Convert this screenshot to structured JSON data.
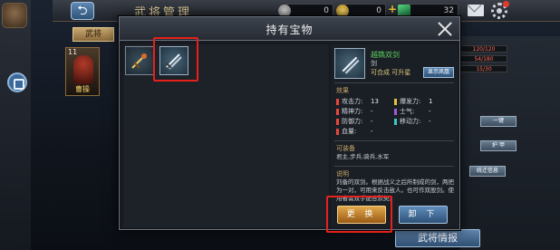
{
  "header": {
    "title": "武将管理",
    "silver": "0",
    "gold": "0",
    "jade": "32",
    "plus": "+"
  },
  "background": {
    "tab_label": "武将",
    "hero": {
      "level": "11",
      "name": "曹操"
    },
    "side_bars": [
      "120/120",
      "54/180",
      "15/30"
    ],
    "side_buttons": [
      "一键",
      "护 甲",
      "统迁信息"
    ],
    "hero_info_button": "武将情报"
  },
  "modal": {
    "title": "持有宝物",
    "detail": {
      "name": "越鐫双剑",
      "type": "剑",
      "status": "可合成  可升星",
      "show_button": "显示凤凰",
      "effects_label": "效果",
      "stats": [
        {
          "key": "攻击力:",
          "value": "13",
          "color": "#e5473a"
        },
        {
          "key": "爆发力:",
          "value": "1",
          "color": "#e6c13a"
        },
        {
          "key": "精神力:",
          "value": "-",
          "color": "#e5473a"
        },
        {
          "key": "士气:",
          "value": "-",
          "color": "#a05ad8"
        },
        {
          "key": "防御力:",
          "value": "-",
          "color": "#e5473a"
        },
        {
          "key": "移动力:",
          "value": "-",
          "color": "#3ac8c8"
        },
        {
          "key": "血量:",
          "value": "-",
          "color": "#e5473a"
        }
      ],
      "equippable_label": "可装备",
      "equippable_text": "君主,步兵,骑兵,水军",
      "desc_label": "说明",
      "desc_text": "刘备的双剑。根据战义之后所制成的剑，两把为一对，可用来反击敌人。也可作双股剑。使用者需双手配合默契。"
    },
    "replace_button": "更 换",
    "unload_button": "卸 下"
  },
  "colors": {
    "highlight": "#e5211c",
    "item_name": "#5ed05e",
    "button_blue": "#2d5279",
    "button_orange": "#9a5a16"
  }
}
